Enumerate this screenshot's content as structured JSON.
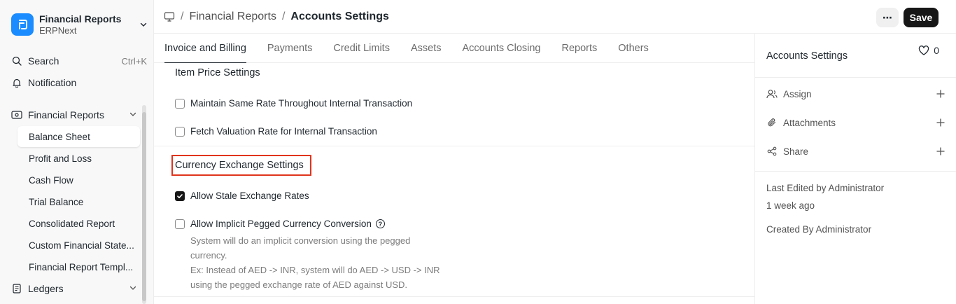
{
  "app": {
    "title": "Financial Reports",
    "subtitle": "ERPNext"
  },
  "sidebar": {
    "search_label": "Search",
    "search_shortcut": "Ctrl+K",
    "notification_label": "Notification",
    "section_label": "Financial Reports",
    "items": [
      {
        "label": "Balance Sheet"
      },
      {
        "label": "Profit and Loss"
      },
      {
        "label": "Cash Flow"
      },
      {
        "label": "Trial Balance"
      },
      {
        "label": "Consolidated Report"
      },
      {
        "label": "Custom Financial State..."
      },
      {
        "label": "Financial Report Templ..."
      }
    ],
    "ledgers_label": "Ledgers"
  },
  "breadcrumb": {
    "parent": "Financial Reports",
    "current": "Accounts Settings",
    "separator": "/"
  },
  "toolbar": {
    "more_label": "⋯",
    "save_label": "Save"
  },
  "tabs": [
    {
      "label": "Invoice and Billing"
    },
    {
      "label": "Payments"
    },
    {
      "label": "Credit Limits"
    },
    {
      "label": "Assets"
    },
    {
      "label": "Accounts Closing"
    },
    {
      "label": "Reports"
    },
    {
      "label": "Others"
    }
  ],
  "main": {
    "item_price_title": "Item Price Settings",
    "maintain_same_rate": {
      "label": "Maintain Same Rate Throughout Internal Transaction",
      "checked": false
    },
    "fetch_valuation": {
      "label": "Fetch Valuation Rate for Internal Transaction",
      "checked": false
    },
    "currency_title": "Currency Exchange Settings",
    "allow_stale": {
      "label": "Allow Stale Exchange Rates",
      "checked": true
    },
    "allow_pegged": {
      "label": "Allow Implicit Pegged Currency Conversion",
      "checked": false
    },
    "pegged_desc_1": "System will do an implicit conversion using the pegged currency.",
    "pegged_desc_2": "Ex: Instead of AED -> INR, system will do AED -> USD -> INR using the pegged exchange rate of AED against USD."
  },
  "right_panel": {
    "title": "Accounts Settings",
    "likes": "0",
    "assign_label": "Assign",
    "attachments_label": "Attachments",
    "share_label": "Share",
    "last_edited": "Last Edited by Administrator",
    "last_edited_time": "1 week ago",
    "created_by": "Created By Administrator"
  },
  "colors": {
    "accent": "#1a8cff",
    "highlight": "#e0341c",
    "save_bg": "#171717"
  }
}
